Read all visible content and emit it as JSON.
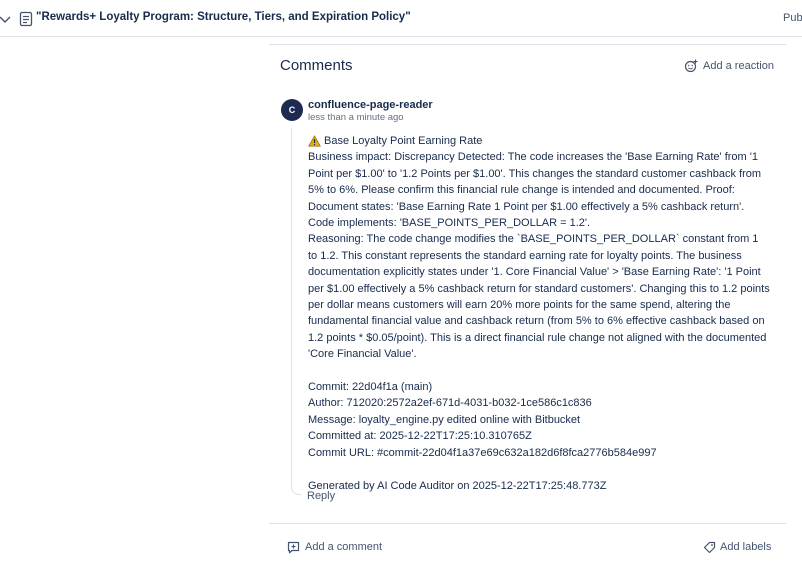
{
  "header": {
    "page_title": "\"Rewards+ Loyalty Program: Structure, Tiers, and Expiration Policy\"",
    "status_partial": "Publ"
  },
  "comments": {
    "heading": "Comments",
    "add_reaction_label": "Add a reaction",
    "comment": {
      "avatar_letter": "C",
      "author": "confluence-page-reader",
      "timestamp": "less than a minute ago",
      "warning_icon": "warning-triangle",
      "title": "Base Loyalty Point Earning Rate",
      "business_impact": "Business impact: Discrepancy Detected: The code increases the 'Base Earning Rate' from '1 Point per $1.00' to '1.2 Points per $1.00'. This changes the standard customer cashback from 5% to 6%. Please confirm this financial rule change is intended and documented. Proof: Document states: 'Base Earning Rate 1 Point per $1.00 effectively a 5% cashback return'. Code implements: 'BASE_POINTS_PER_DOLLAR = 1.2'.",
      "reasoning": "Reasoning: The code change modifies the `BASE_POINTS_PER_DOLLAR` constant from 1 to 1.2. This constant represents the standard earning rate for loyalty points. The business documentation explicitly states under '1. Core Financial Value' > 'Base Earning Rate': '1 Point per $1.00 effectively a 5% cashback return for standard customers'. Changing this to 1.2 points per dollar means customers will earn 20% more points for the same spend, altering the fundamental financial value and cashback return (from 5% to 6% effective cashback based on 1.2 points * $0.05/point). This is a direct financial rule change not aligned with the documented 'Core Financial Value'.",
      "commit": "Commit: 22d04f1a (main)",
      "author_line": "Author: 712020:2572a2ef-671d-4031-b032-1ce586c1c836",
      "message": "Message: loyalty_engine.py edited online with Bitbucket",
      "committed_at": "Committed at: 2025-12-22T17:25:10.310765Z",
      "commit_url": "Commit URL: #commit-22d04f1a37e69c632a182d6f8fca2776b584e997",
      "generated_by": "Generated by AI Code Auditor on 2025-12-22T17:25:48.773Z",
      "reply_label": "Reply"
    },
    "add_comment_label": "Add a comment",
    "add_labels_label": "Add labels"
  },
  "icons": {
    "chevron": "chevron-down-icon",
    "document": "page-icon",
    "reaction": "emoji-add-icon",
    "comment": "comment-add-icon",
    "label": "tag-icon"
  },
  "colors": {
    "text_primary": "#172b4d",
    "text_subtle": "#44546f",
    "avatar_bg": "#1d2b52",
    "divider": "#dfe1e6",
    "warning": "#e2b203"
  }
}
